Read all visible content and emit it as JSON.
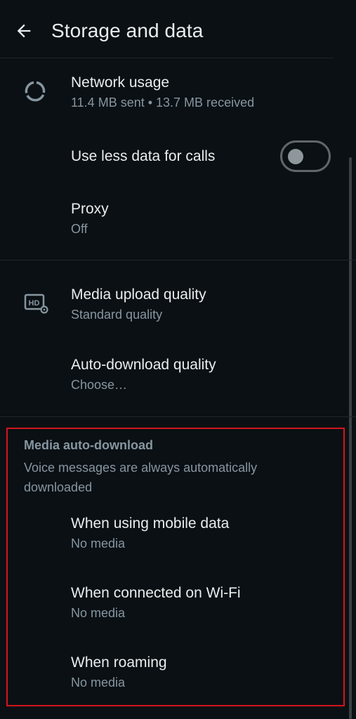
{
  "header": {
    "title": "Storage and data"
  },
  "network": {
    "title": "Network usage",
    "subtitle": "11.4 MB sent • 13.7 MB received"
  },
  "calls": {
    "title": "Use less data for calls",
    "toggle_on": false
  },
  "proxy": {
    "title": "Proxy",
    "subtitle": "Off"
  },
  "upload": {
    "title": "Media upload quality",
    "subtitle": "Standard quality"
  },
  "auto_quality": {
    "title": "Auto-download quality",
    "subtitle": "Choose…"
  },
  "auto_download": {
    "section_title": "Media auto-download",
    "description": "Voice messages are always automatically downloaded",
    "items": [
      {
        "title": "When using mobile data",
        "subtitle": "No media"
      },
      {
        "title": "When connected on Wi-Fi",
        "subtitle": "No media"
      },
      {
        "title": "When roaming",
        "subtitle": "No media"
      }
    ]
  },
  "colors": {
    "background": "#0b1014",
    "primary_text": "#e9edef",
    "secondary_text": "#8696a0",
    "highlight": "#d2151e"
  }
}
